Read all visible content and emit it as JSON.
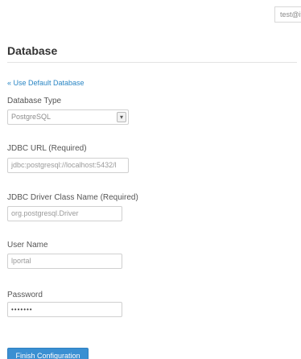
{
  "header": {
    "user_email": "test@iten"
  },
  "page": {
    "title": "Database"
  },
  "default_db_link": "« Use Default Database",
  "form": {
    "db_type": {
      "label": "Database Type",
      "value": "PostgreSQL"
    },
    "jdbc_url": {
      "label": "JDBC URL (Required)",
      "value": "jdbc:postgresql://localhost:5432/l"
    },
    "driver_class": {
      "label": "JDBC Driver Class Name (Required)",
      "value": "org.postgresql.Driver"
    },
    "user_name": {
      "label": "User Name",
      "value": "lportal"
    },
    "password": {
      "label": "Password",
      "value": "•••••••"
    }
  },
  "finish_button": "Finish Configuration",
  "colors": {
    "accent": "#3a8fd2",
    "link": "#2a86c4"
  }
}
